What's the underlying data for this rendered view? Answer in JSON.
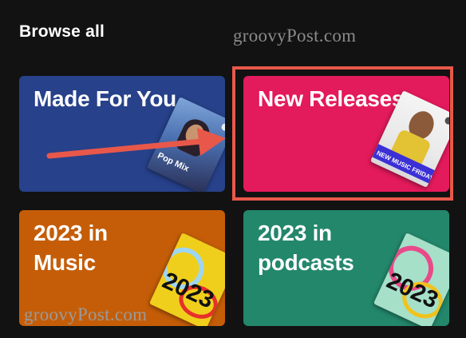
{
  "header": {
    "title": "Browse all"
  },
  "watermark": {
    "text": "groovyPost.com"
  },
  "cards": [
    {
      "title": "Made For You",
      "color": "#27418a",
      "art_label": "Pop Mix"
    },
    {
      "title": "New Releases",
      "color": "#e31a5c",
      "art_label": "NEW MUSIC FRIDAY"
    },
    {
      "title": "2023 in Music",
      "color": "#c55d08",
      "art_label": "2023"
    },
    {
      "title": "2023 in podcasts",
      "color": "#23876b",
      "art_label": "2023"
    }
  ],
  "annotations": {
    "highlight_color": "#e8584a",
    "arrow_color": "#e8584a"
  }
}
